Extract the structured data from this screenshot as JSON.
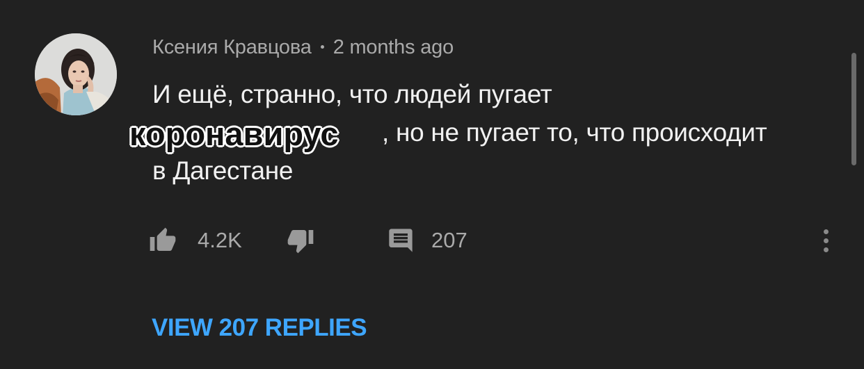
{
  "comment": {
    "author": "Ксения Кравцова",
    "timestamp": "2 months ago",
    "text_line_1": "И ещё, странно, что людей пугает",
    "text_line_2_rest": ", но не пугает то, что происходит",
    "text_line_3": "в Дагестане",
    "overlay_sticker_text": "коронавирус",
    "like_count": "4.2K",
    "reply_count": "207",
    "view_replies_label": "VIEW 207 REPLIES"
  },
  "icons": {
    "like": "thumb-up-icon",
    "dislike": "thumb-down-icon",
    "reply": "comment-icon",
    "more": "more-vert-icon"
  },
  "colors": {
    "background": "#212121",
    "text_primary": "#f1f1f1",
    "text_secondary": "#aaaaaa",
    "link": "#3ea6ff"
  }
}
